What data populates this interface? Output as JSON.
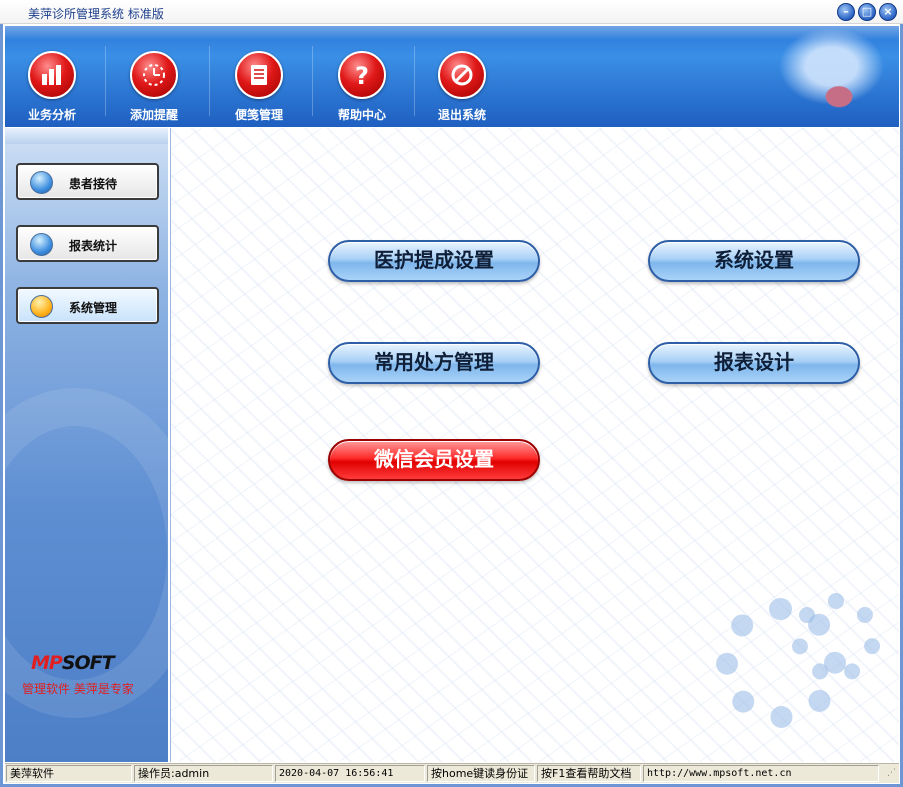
{
  "window": {
    "title": "美萍诊所管理系统 标准版",
    "controls": {
      "minimize": "–",
      "maximize": "□",
      "close": "×"
    }
  },
  "toolbar": {
    "items": [
      {
        "label": "业务分析",
        "icon": "bar-chart-icon"
      },
      {
        "label": "添加提醒",
        "icon": "clock-icon"
      },
      {
        "label": "便笺管理",
        "icon": "notepad-icon"
      },
      {
        "label": "帮助中心",
        "icon": "question-icon"
      },
      {
        "label": "退出系统",
        "icon": "exit-icon"
      }
    ]
  },
  "sidebar": {
    "items": [
      {
        "label": "患者接待",
        "active": false
      },
      {
        "label": "报表统计",
        "active": false
      },
      {
        "label": "系统管理",
        "active": true
      }
    ],
    "logo": {
      "mp": "MP",
      "soft": "SOFT"
    },
    "slogan": "管理软件  美萍是专家"
  },
  "main": {
    "buttons": [
      {
        "label": "医护提成设置"
      },
      {
        "label": "系统设置"
      },
      {
        "label": "常用处方管理"
      },
      {
        "label": "报表设计"
      },
      {
        "label": "微信会员设置",
        "highlighted": true
      }
    ]
  },
  "statusbar": {
    "app_name": "美萍软件",
    "operator": "操作员:admin",
    "datetime": "2020-04-07 16:56:41",
    "home_hint": "按home键读身份证",
    "f1_hint": "按F1查看帮助文档",
    "url": "http://www.mpsoft.net.cn"
  },
  "colors": {
    "header_blue": "#2a76d8",
    "icon_red": "#e01818",
    "pill_blue": "#a8d0f6",
    "pill_red": "#ff2b2b",
    "slogan_red": "#e02020"
  }
}
